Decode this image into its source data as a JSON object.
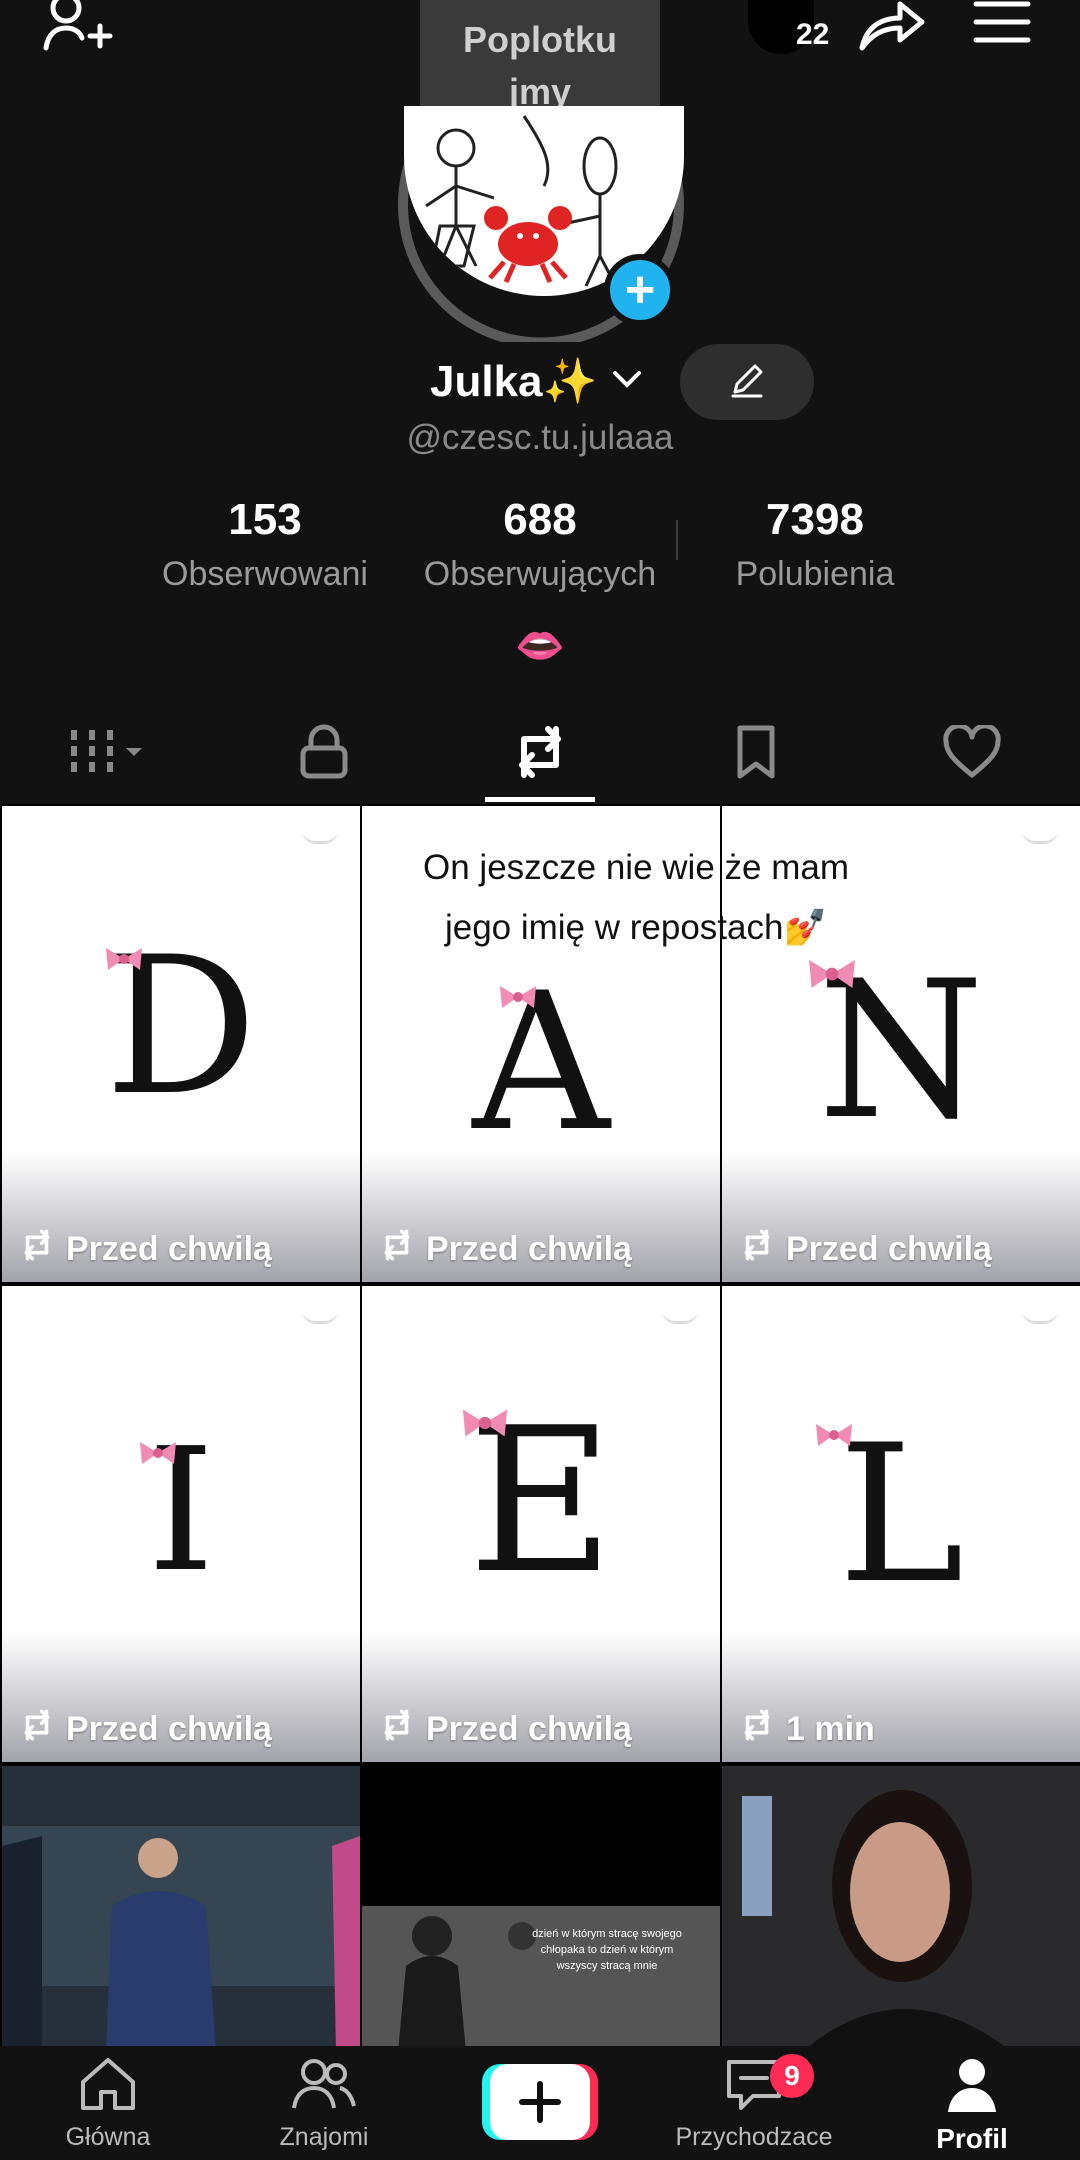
{
  "tooltip": {
    "text": "Poplotkujmy"
  },
  "header": {
    "story_count": "22"
  },
  "profile": {
    "display_name": "Julka✨",
    "username": "@czesc.tu.julaaa",
    "bio": "👄"
  },
  "stats": [
    {
      "value": "153",
      "label": "Obserwowani"
    },
    {
      "value": "688",
      "label": "Obserwujących"
    },
    {
      "value": "7398",
      "label": "Polubienia"
    }
  ],
  "tabs": [
    {
      "icon": "grid-icon",
      "active": false
    },
    {
      "icon": "lock-icon",
      "active": false
    },
    {
      "icon": "repost-icon",
      "active": true
    },
    {
      "icon": "bookmark-icon",
      "active": false
    },
    {
      "icon": "heart-icon",
      "active": false
    }
  ],
  "caption": {
    "line1": "On jeszcze nie wie że mam",
    "line2": "jego imię w repostach💅"
  },
  "grid": {
    "items": [
      {
        "letter": "D",
        "time": "Przed chwilą"
      },
      {
        "letter": "A",
        "time": "Przed chwilą"
      },
      {
        "letter": "N",
        "time": "Przed chwilą"
      },
      {
        "letter": "I",
        "time": "Przed chwilą"
      },
      {
        "letter": "E",
        "time": "Przed chwilą"
      },
      {
        "letter": "L",
        "time": "1 min"
      }
    ],
    "video_overlay_text": "dzień w którym stracę swojego chłopaka to dzień w którym wszyscy stracą mnie"
  },
  "nav": {
    "home": "Główna",
    "friends": "Znajomi",
    "inbox": "Przychodzace",
    "profile": "Profil",
    "inbox_badge": "9"
  },
  "colors": {
    "accent_blue": "#20b3f0",
    "badge_red": "#fe2c55",
    "background": "#121212"
  }
}
